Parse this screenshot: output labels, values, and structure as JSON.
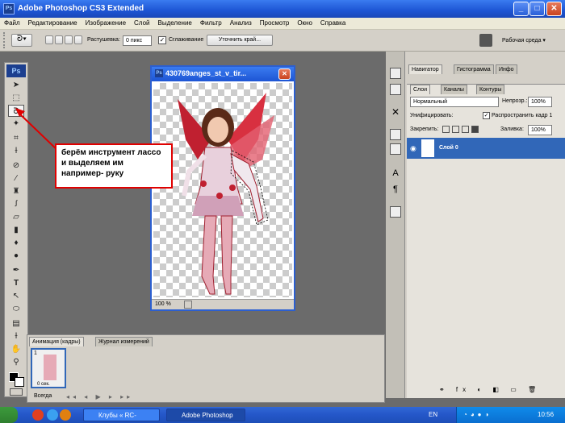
{
  "window": {
    "title": "Adobe Photoshop CS3 Extended",
    "app_icon": "Ps"
  },
  "menu": [
    "Файл",
    "Редактирование",
    "Изображение",
    "Слой",
    "Выделение",
    "Фильтр",
    "Анализ",
    "Просмотр",
    "Окно",
    "Справка"
  ],
  "options_bar": {
    "feather_label": "Растушевка:",
    "feather_value": "0 пикс",
    "antialias_label": "Сглаживание",
    "antialias_checked": true,
    "refine_edge_label": "Уточнить край...",
    "workspace_label": "Рабочая среда ▾"
  },
  "toolbox": {
    "logo": "Ps"
  },
  "document": {
    "title": "430769anges_st_v_tir...",
    "zoom": "100 %"
  },
  "annotation": {
    "text": "берём инструмент лассо и выделяем им например- руку"
  },
  "navigator_tabs": [
    "Навигатор",
    "Гистограмма",
    "Инфо"
  ],
  "layers_panel": {
    "tabs": [
      "Слои",
      "Каналы",
      "Контуры"
    ],
    "blend_mode": "Нормальный",
    "opacity_label": "Непрозр.:",
    "opacity_value": "100%",
    "unify_label": "Унифицировать:",
    "propagate_label": "Распространить кадр 1",
    "lock_label": "Закрепить:",
    "fill_label": "Заливка:",
    "fill_value": "100%",
    "layer_name": "Слой 0"
  },
  "animation_panel": {
    "tabs": [
      "Анимация (кадры)",
      "Журнал измерений"
    ],
    "frame_number": "1",
    "frame_delay": "0 сек.",
    "loop_label": "Всегда"
  },
  "taskbar": {
    "tasks": [
      "Клубы « RC-MIR.co...",
      "Adobe Photoshop CS..."
    ],
    "language": "EN",
    "clock": "10:56"
  },
  "colors": {
    "accent": "#2c5fd0",
    "highlight": "#3167b8",
    "annotation": "#e00000"
  }
}
